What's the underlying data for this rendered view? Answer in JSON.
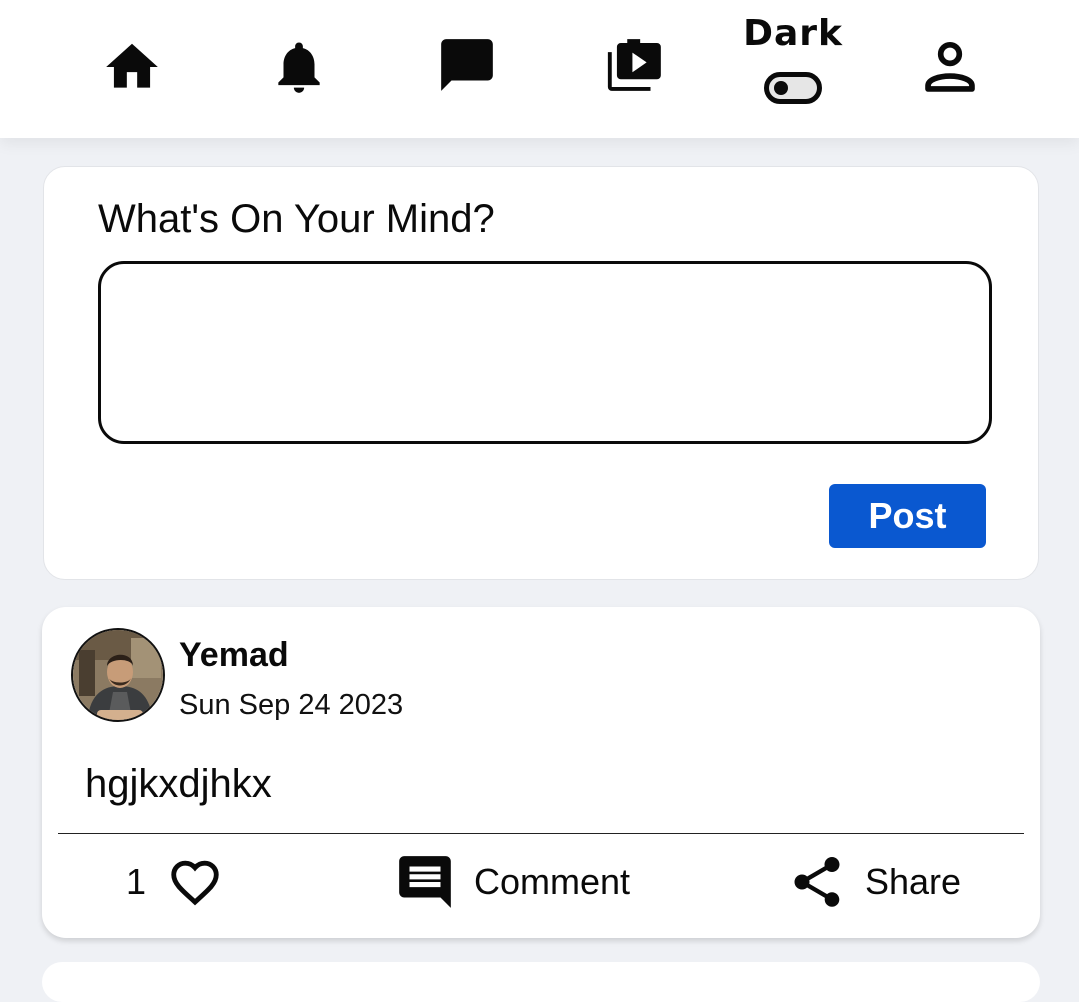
{
  "nav": {
    "items": [
      {
        "name": "home",
        "icon": "home-icon"
      },
      {
        "name": "notifications",
        "icon": "bell-icon"
      },
      {
        "name": "messages",
        "icon": "chat-icon"
      },
      {
        "name": "videos",
        "icon": "video-library-icon"
      },
      {
        "name": "profile",
        "icon": "person-icon"
      }
    ],
    "theme_toggle": {
      "label": "Dark",
      "enabled": false
    }
  },
  "composer": {
    "title": "What's On Your Mind?",
    "input_value": "",
    "post_label": "Post",
    "post_color": "#0a58d0"
  },
  "post": {
    "author": "Yemad",
    "date": "Sun Sep 24 2023",
    "text": "hgjkxdjhkx",
    "likes": "1",
    "comment_label": "Comment",
    "share_label": "Share"
  }
}
